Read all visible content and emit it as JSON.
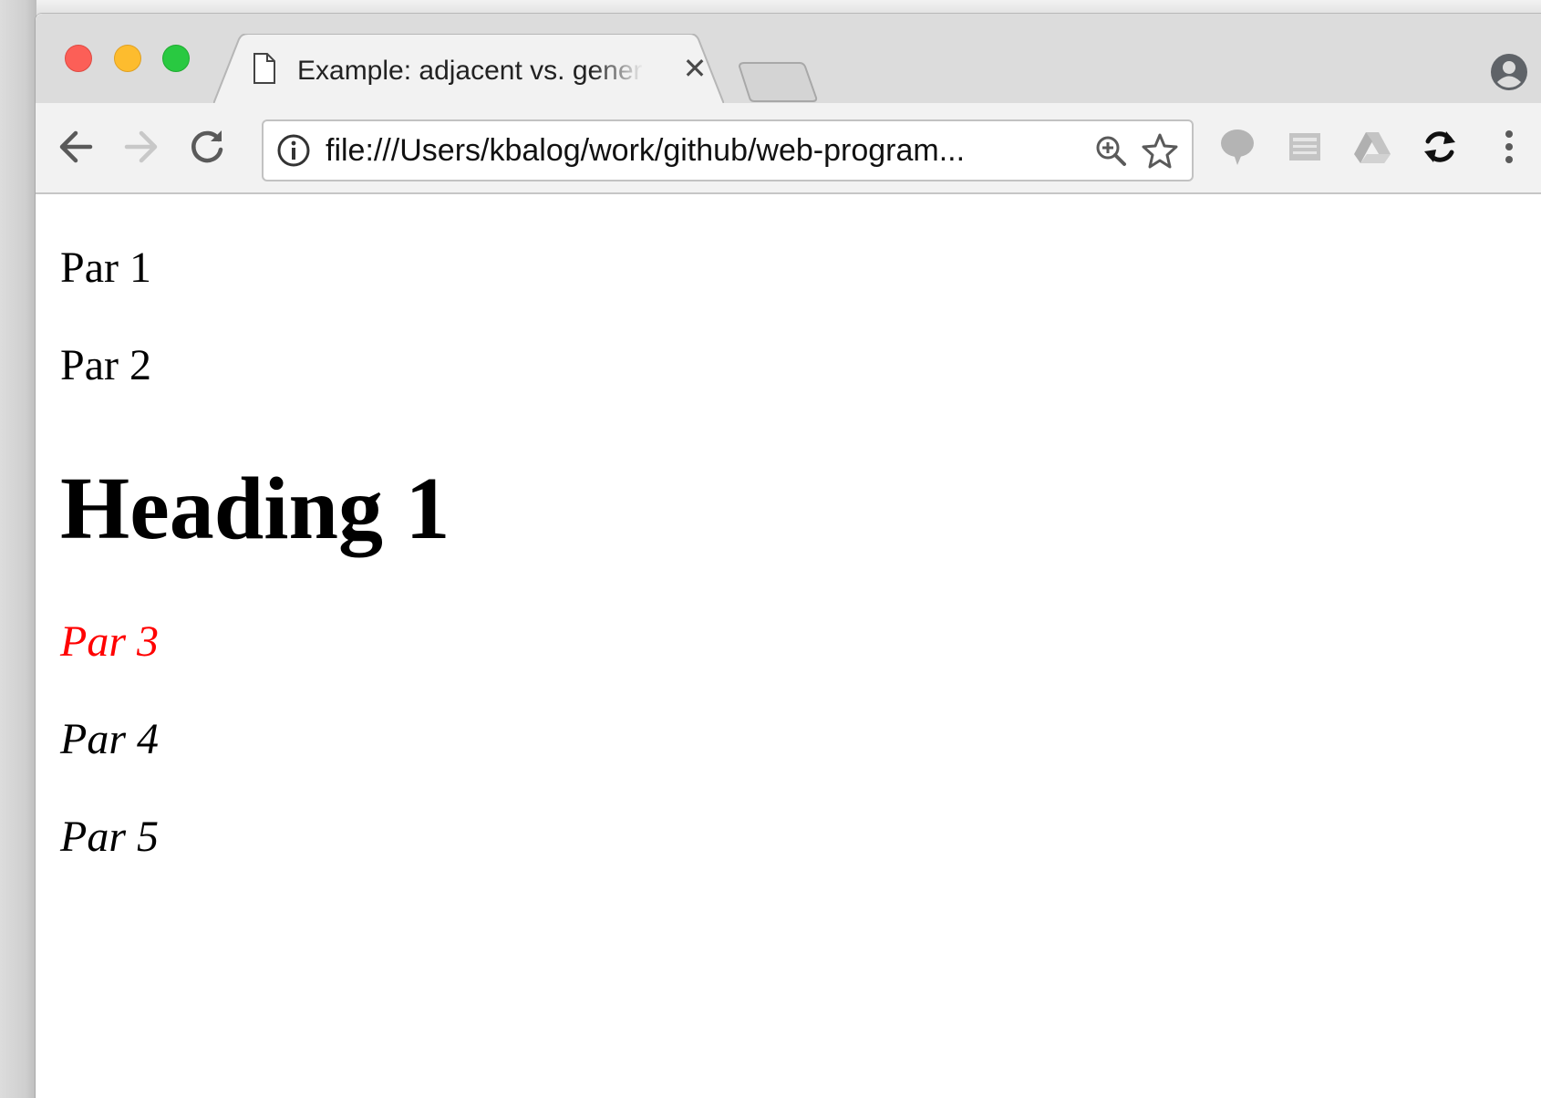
{
  "browser": {
    "tab": {
      "title": "Example: adjacent vs. general sibling",
      "close_glyph": "✕",
      "favicon": "page-icon"
    },
    "toolbar": {
      "url": "file:///Users/kbalog/work/github/web-program...",
      "icons": [
        "back-arrow-icon",
        "forward-arrow-icon",
        "reload-icon",
        "info-icon",
        "zoom-icon",
        "star-icon",
        "speech-bubble-icon",
        "document-icon",
        "drive-icon",
        "sync-icon",
        "more-menu-icon"
      ]
    },
    "window_controls": [
      "close",
      "minimize",
      "maximize"
    ],
    "colors": {
      "close": "#fc5f57",
      "minimize": "#fdbc2e",
      "maximize": "#29c941",
      "highlight_red": "#ff0000"
    }
  },
  "page": {
    "paragraph_1": "Par 1",
    "paragraph_2": "Par 2",
    "heading_1": "Heading 1",
    "paragraph_3": "Par 3",
    "paragraph_4": "Par 4",
    "paragraph_5": "Par 5"
  }
}
